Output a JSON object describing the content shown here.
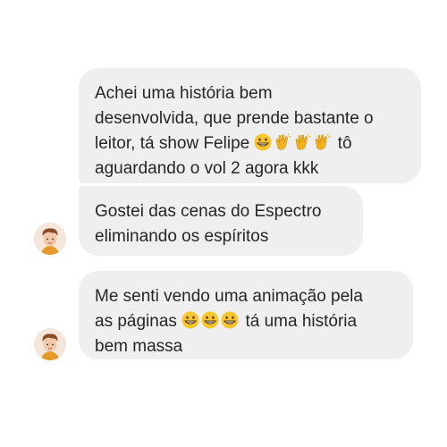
{
  "messages": [
    {
      "parts": [
        "Achei uma história bem\ndesenvolvida, que prende bastante o\nleitor, tá show Felipe ",
        " tô\naguardando o vol 2 agora kkk"
      ],
      "emojis": [
        "grinning-face",
        "clapping-hands",
        "clapping-hands",
        "clapping-hands"
      ]
    },
    {
      "text": "Gostei das cenas do Espectro\neliminando os espíritos"
    },
    {
      "parts": [
        "Me senti vendo uma animação pela\nas páginas ",
        " tá uma história\nbem massa"
      ],
      "emojis": [
        "grinning-face",
        "grinning-face",
        "grinning-face"
      ]
    }
  ],
  "colors": {
    "bubble_background": "#efefef",
    "text": "#262626"
  }
}
